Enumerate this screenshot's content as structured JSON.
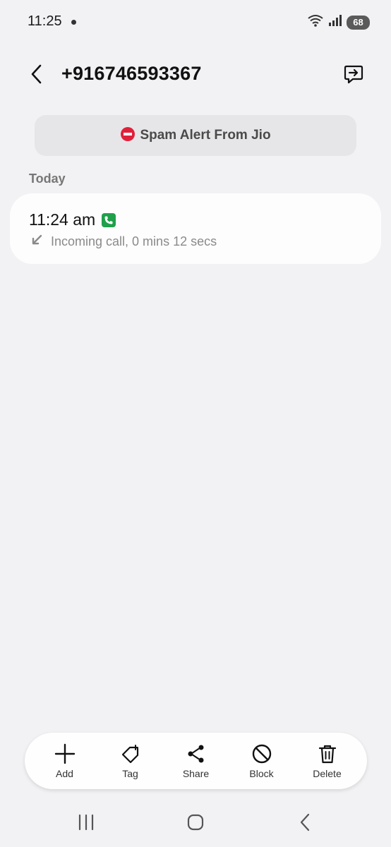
{
  "status_bar": {
    "time": "11:25",
    "battery": "68",
    "icons": [
      "wifi-icon",
      "signal-icon",
      "battery-icon"
    ]
  },
  "header": {
    "phone_number": "+916746593367"
  },
  "spam_banner": {
    "text": "Spam Alert From Jio",
    "icon": "no-entry-icon"
  },
  "section": {
    "title": "Today"
  },
  "call_log": {
    "items": [
      {
        "time": "11:24 am",
        "detail": "Incoming call, 0 mins 12 secs",
        "type_icon": "phone-icon",
        "direction_icon": "incoming-arrow-icon"
      }
    ]
  },
  "actions": [
    {
      "label": "Add",
      "icon": "plus-icon"
    },
    {
      "label": "Tag",
      "icon": "tag-icon"
    },
    {
      "label": "Share",
      "icon": "share-icon"
    },
    {
      "label": "Block",
      "icon": "block-icon"
    },
    {
      "label": "Delete",
      "icon": "trash-icon"
    }
  ],
  "nav": [
    "recents-icon",
    "home-icon",
    "back-icon"
  ],
  "colors": {
    "background": "#f2f2f4",
    "card": "#fdfdfe",
    "banner": "#e6e6e8",
    "call_icon_green": "#1fa04a",
    "spam_red": "#e0203a"
  }
}
